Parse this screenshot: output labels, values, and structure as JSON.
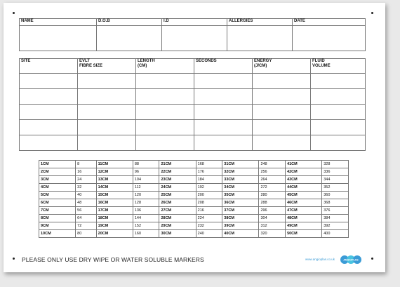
{
  "patient_table": {
    "headers": [
      "NAME",
      "D.O.B",
      "I.D",
      "ALLERGIES",
      "DATE"
    ]
  },
  "treatment_table": {
    "headers": [
      [
        "SITE",
        ""
      ],
      [
        "EVLT",
        "FIBRE SIZE"
      ],
      [
        "LENGTH",
        "(CM)"
      ],
      [
        "SECONDS",
        ""
      ],
      [
        "ENERGY",
        "(J/CM)"
      ],
      [
        "FLUID",
        "VOLUME"
      ]
    ],
    "row_count": 5
  },
  "conversion_table": {
    "columns": [
      {
        "cm": [
          "1CM",
          "2CM",
          "3CM",
          "4CM",
          "5CM",
          "6CM",
          "7CM",
          "8CM",
          "9CM",
          "10CM"
        ],
        "values": [
          "8",
          "16",
          "24",
          "32",
          "40",
          "48",
          "56",
          "64",
          "72",
          "80"
        ]
      },
      {
        "cm": [
          "11CM",
          "12CM",
          "13CM",
          "14CM",
          "15CM",
          "16CM",
          "17CM",
          "18CM",
          "19CM",
          "20CM"
        ],
        "values": [
          "88",
          "96",
          "104",
          "112",
          "120",
          "128",
          "136",
          "144",
          "152",
          "160"
        ]
      },
      {
        "cm": [
          "21CM",
          "22CM",
          "23CM",
          "24CM",
          "25CM",
          "26CM",
          "27CM",
          "28CM",
          "29CM",
          "30CM"
        ],
        "values": [
          "168",
          "176",
          "184",
          "192",
          "200",
          "208",
          "216",
          "224",
          "232",
          "240"
        ]
      },
      {
        "cm": [
          "31CM",
          "32CM",
          "33CM",
          "34CM",
          "35CM",
          "36CM",
          "37CM",
          "38CM",
          "39CM",
          "40CM"
        ],
        "values": [
          "248",
          "256",
          "264",
          "272",
          "280",
          "288",
          "296",
          "304",
          "312",
          "320"
        ]
      },
      {
        "cm": [
          "41CM",
          "42CM",
          "43CM",
          "44CM",
          "45CM",
          "46CM",
          "47CM",
          "48CM",
          "49CM",
          "50CM"
        ],
        "values": [
          "328",
          "336",
          "344",
          "352",
          "360",
          "368",
          "376",
          "384",
          "392",
          "400"
        ]
      }
    ]
  },
  "footer": {
    "notice": "PLEASE ONLY USE DRY WIPE OR WATER SOLUBLE MARKERS",
    "website": "www.angioplas.co.uk",
    "logo_text": "ANGIOPLAS"
  },
  "colors": {
    "logo_primary": "#3a9bd6",
    "logo_secondary": "#49c3e0"
  }
}
